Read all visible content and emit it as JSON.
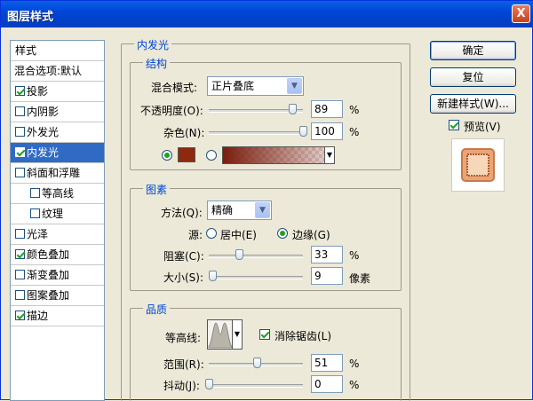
{
  "window": {
    "title": "图层样式",
    "close": "X"
  },
  "sidebar": {
    "header": "样式",
    "items": [
      {
        "label": "混合选项:默认",
        "checkbox": false
      },
      {
        "label": "投影",
        "checkbox": true,
        "checked": true
      },
      {
        "label": "内阴影",
        "checkbox": true,
        "checked": false
      },
      {
        "label": "外发光",
        "checkbox": true,
        "checked": false
      },
      {
        "label": "内发光",
        "checkbox": true,
        "checked": true,
        "selected": true
      },
      {
        "label": "斜面和浮雕",
        "checkbox": true,
        "checked": false
      },
      {
        "label": "等高线",
        "checkbox": true,
        "checked": false,
        "indent": true
      },
      {
        "label": "纹理",
        "checkbox": true,
        "checked": false,
        "indent": true
      },
      {
        "label": "光泽",
        "checkbox": true,
        "checked": false
      },
      {
        "label": "颜色叠加",
        "checkbox": true,
        "checked": true
      },
      {
        "label": "渐变叠加",
        "checkbox": true,
        "checked": false
      },
      {
        "label": "图案叠加",
        "checkbox": true,
        "checked": false
      },
      {
        "label": "描边",
        "checkbox": true,
        "checked": true
      }
    ]
  },
  "inner_glow": {
    "title": "内发光",
    "structure": {
      "title": "结构",
      "blend_mode_label": "混合模式:",
      "blend_mode_value": "正片叠底",
      "opacity_label": "不透明度(O):",
      "opacity_value": "89",
      "opacity_unit": "%",
      "opacity_level": 0.89,
      "noise_label": "杂色(N):",
      "noise_value": "100",
      "noise_unit": "%",
      "noise_level": 1.0,
      "color": "#8c2a0e"
    },
    "elements": {
      "title": "图素",
      "method_label": "方法(Q):",
      "method_value": "精确",
      "source_label": "源:",
      "source_center": "居中(E)",
      "source_edge": "边缘(G)",
      "choke_label": "阻塞(C):",
      "choke_value": "33",
      "choke_unit": "%",
      "choke_level": 0.33,
      "size_label": "大小(S):",
      "size_value": "9",
      "size_unit": "像素",
      "size_level": 0.04
    },
    "quality": {
      "title": "品质",
      "contour_label": "等高线:",
      "antialias_label": "消除锯齿(L)",
      "range_label": "范围(R):",
      "range_value": "51",
      "range_unit": "%",
      "range_level": 0.51,
      "jitter_label": "抖动(J):",
      "jitter_value": "0",
      "jitter_unit": "%",
      "jitter_level": 0
    }
  },
  "buttons": {
    "ok": "确定",
    "reset": "复位",
    "new_style": "新建样式(W)...",
    "preview_label": "预览(V)"
  }
}
